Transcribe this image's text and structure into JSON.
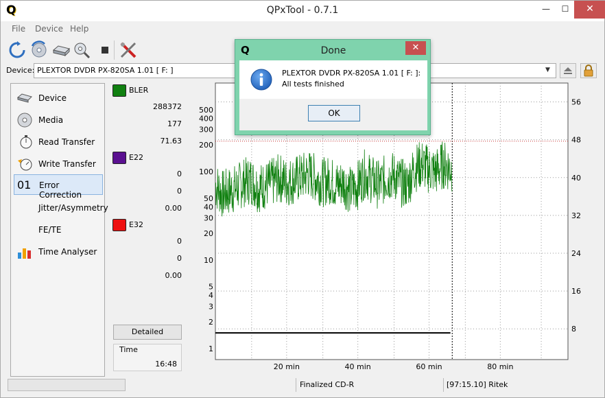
{
  "window": {
    "title": "QPxTool - 0.7.1",
    "logo": "Q",
    "minimize": "—",
    "maximize": "☐",
    "close": "✕"
  },
  "menu": [
    "File",
    "Device",
    "Help"
  ],
  "device": {
    "label": "Device:",
    "selected": "PLEXTOR  DVDR   PX-820SA  1.01 [ F: ]"
  },
  "nav": [
    {
      "label": "Device",
      "icon": "device-drive-icon"
    },
    {
      "label": "Media",
      "icon": "disc-media-icon"
    },
    {
      "label": "Read Transfer",
      "icon": "stopwatch-read-icon"
    },
    {
      "label": "Write Transfer",
      "icon": "stopwatch-write-icon"
    },
    {
      "label": "Error Correction",
      "icon": "01",
      "selected": true
    },
    {
      "label": "Jitter/Asymmetry",
      "icon": ""
    },
    {
      "label": "FE/TE",
      "icon": ""
    },
    {
      "label": "Time Analyser",
      "icon": "bar-chart-icon"
    }
  ],
  "series_panel": {
    "bler": {
      "name": "BLER",
      "color": "#108010",
      "total": "288372",
      "max": "177",
      "avg": "71.63"
    },
    "e22": {
      "name": "E22",
      "color": "#5a1090",
      "total": "0",
      "max": "0",
      "avg": "0.00"
    },
    "e32": {
      "name": "E32",
      "color": "#ee1010",
      "total": "0",
      "max": "0",
      "avg": "0.00"
    },
    "detailed_button": "Detailed",
    "time_label": "Time",
    "time_value": "16:48"
  },
  "status": {
    "disc": "Finalized CD-R",
    "media": "[97:15.10] Ritek"
  },
  "dialog": {
    "logo": "Q",
    "title": "Done",
    "close": "✕",
    "line1": "PLEXTOR  DVDR   PX-820SA  1.01 [ F: ]:",
    "line2": "All tests finished",
    "ok": "OK"
  },
  "chart_data": {
    "type": "line",
    "y_scale": "log",
    "x_tick_labels": [
      "20 min",
      "40 min",
      "60 min",
      "80 min"
    ],
    "x_ticks": [
      20,
      40,
      60,
      80
    ],
    "x_range": [
      0,
      99
    ],
    "y_left_ticks": [
      1,
      2,
      3,
      4,
      5,
      10,
      20,
      30,
      40,
      50,
      100,
      200,
      300,
      400,
      500
    ],
    "y_left_range": [
      0.75,
      1000
    ],
    "y_right_ticks": [
      8,
      16,
      24,
      32,
      40,
      48,
      56
    ],
    "y_right_range": [
      1.5,
      60
    ],
    "disc_end_min": 66.5,
    "threshold_bler": 220,
    "bler_color": "#108010",
    "speed_color": "#000000",
    "series": [
      {
        "name": "BLER",
        "x": [
          0,
          2,
          4,
          6,
          8,
          10,
          12,
          14,
          16,
          18,
          20,
          22,
          24,
          26,
          28,
          30,
          32,
          34,
          36,
          38,
          40,
          42,
          44,
          46,
          48,
          50,
          52,
          54,
          56,
          58,
          60,
          62,
          64,
          66
        ],
        "y": [
          70,
          55,
          60,
          65,
          75,
          80,
          65,
          70,
          75,
          85,
          75,
          80,
          85,
          95,
          85,
          75,
          80,
          70,
          75,
          60,
          70,
          95,
          80,
          70,
          85,
          90,
          75,
          70,
          110,
          120,
          105,
          100,
          120,
          110
        ]
      },
      {
        "name": "Speed",
        "x": [
          0,
          66
        ],
        "y": [
          1.5,
          1.5
        ]
      }
    ]
  }
}
